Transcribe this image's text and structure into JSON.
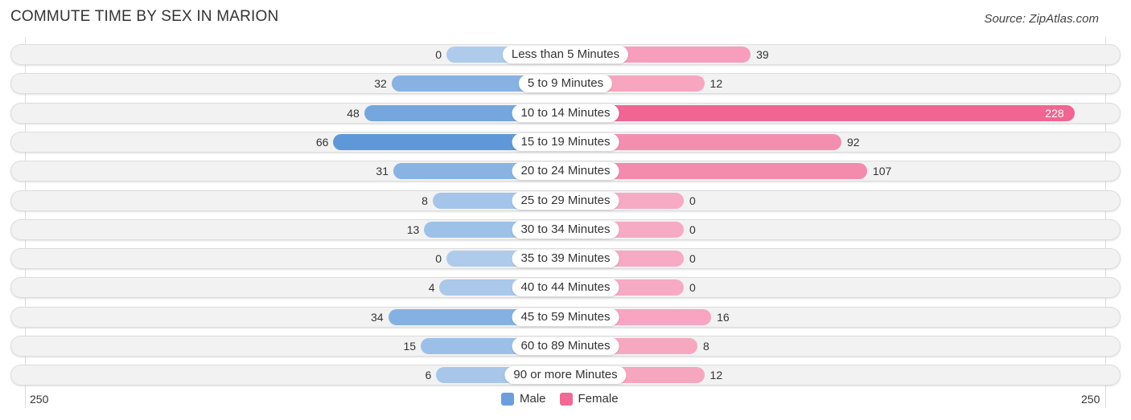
{
  "chart_data": {
    "type": "bar",
    "orientation": "horizontal-diverging",
    "title": "COMMUTE TIME BY SEX IN MARION",
    "source": "Source: ZipAtlas.com",
    "categories": [
      "Less than 5 Minutes",
      "5 to 9 Minutes",
      "10 to 14 Minutes",
      "15 to 19 Minutes",
      "20 to 24 Minutes",
      "25 to 29 Minutes",
      "30 to 34 Minutes",
      "35 to 39 Minutes",
      "40 to 44 Minutes",
      "45 to 59 Minutes",
      "60 to 89 Minutes",
      "90 or more Minutes"
    ],
    "series": [
      {
        "name": "Male",
        "color": "#6a9fdb",
        "values": [
          0,
          32,
          48,
          66,
          31,
          8,
          13,
          0,
          4,
          34,
          15,
          6
        ]
      },
      {
        "name": "Female",
        "color": "#f06a94",
        "values": [
          39,
          12,
          228,
          92,
          107,
          0,
          0,
          0,
          0,
          16,
          8,
          12
        ]
      }
    ],
    "axis": {
      "left_label": "250",
      "right_label": "250",
      "range": [
        -250,
        250
      ]
    },
    "legend": {
      "position": "bottom-center",
      "items": [
        "Male",
        "Female"
      ]
    }
  }
}
